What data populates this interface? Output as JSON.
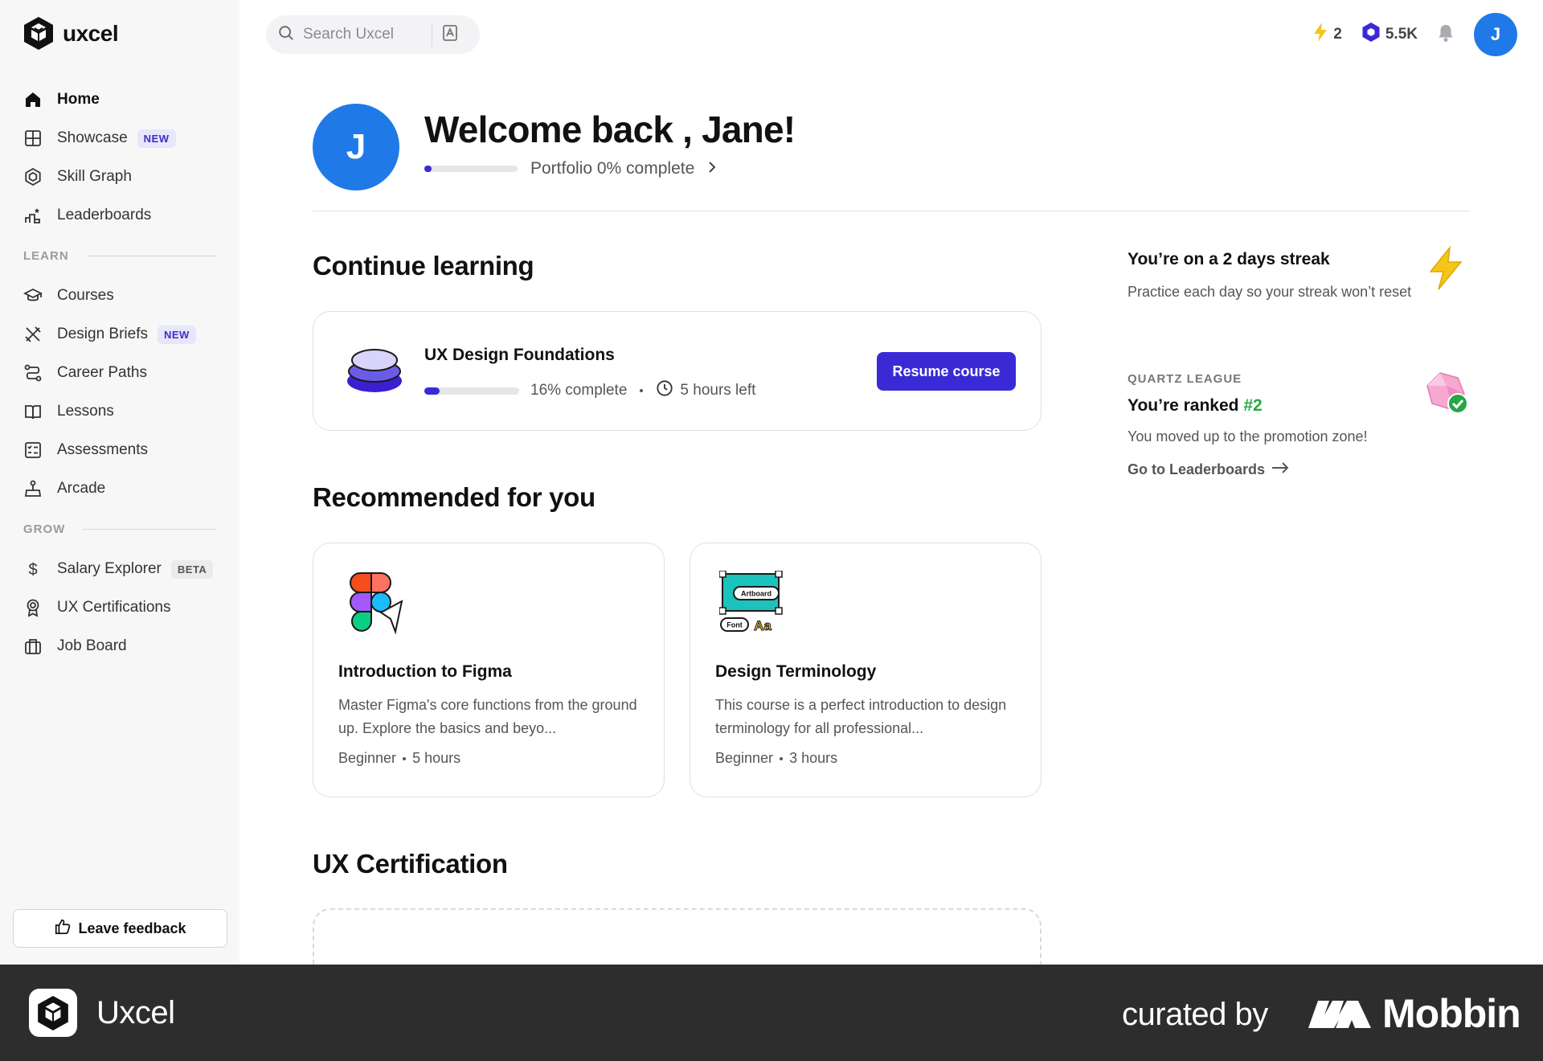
{
  "app": {
    "name": "uxcel"
  },
  "sidebar": {
    "items": [
      {
        "label": "Home",
        "icon": "home-icon",
        "active": true
      },
      {
        "label": "Showcase",
        "icon": "showcase-icon",
        "badge": "NEW"
      },
      {
        "label": "Skill Graph",
        "icon": "skill-graph-icon"
      },
      {
        "label": "Leaderboards",
        "icon": "leaderboards-icon"
      }
    ],
    "learn_label": "LEARN",
    "learn_items": [
      {
        "label": "Courses",
        "icon": "graduation-cap-icon"
      },
      {
        "label": "Design Briefs",
        "icon": "design-briefs-icon",
        "badge": "NEW"
      },
      {
        "label": "Career Paths",
        "icon": "career-paths-icon"
      },
      {
        "label": "Lessons",
        "icon": "book-icon"
      },
      {
        "label": "Assessments",
        "icon": "assessments-icon"
      },
      {
        "label": "Arcade",
        "icon": "arcade-icon"
      }
    ],
    "grow_label": "GROW",
    "grow_items": [
      {
        "label": "Salary Explorer",
        "icon": "dollar-icon",
        "badge": "BETA"
      },
      {
        "label": "UX Certifications",
        "icon": "certification-icon"
      },
      {
        "label": "Job Board",
        "icon": "briefcase-icon"
      }
    ],
    "feedback_label": "Leave feedback"
  },
  "header": {
    "search_placeholder": "Search Uxcel",
    "streak_count": "2",
    "xp": "5.5K",
    "avatar_initial": "J"
  },
  "welcome": {
    "avatar_initial": "J",
    "title": "Welcome back , Jane!",
    "portfolio_text": "Portfolio 0% complete",
    "portfolio_progress": 0.02
  },
  "continue": {
    "heading": "Continue learning",
    "course_title": "UX Design Foundations",
    "progress_text": "16% complete",
    "progress": 0.16,
    "time_left": "5 hours left",
    "button": "Resume course"
  },
  "recommended": {
    "heading": "Recommended for you",
    "cards": [
      {
        "title": "Introduction to Figma",
        "description": "Master Figma's core functions from the ground up. Explore the basics and beyo...",
        "level": "Beginner",
        "duration": "5 hours",
        "icon": "figma-icon"
      },
      {
        "title": "Design Terminology",
        "description": "This course is a perfect introduction to design terminology for all professional...",
        "level": "Beginner",
        "duration": "3 hours",
        "icon": "artboard-icon",
        "icon_labels": [
          "Artboard",
          "Font",
          "Aa"
        ]
      }
    ]
  },
  "certification": {
    "heading": "UX Certification"
  },
  "streak": {
    "title": "You’re on a 2 days streak",
    "description": "Practice each day so your streak won’t reset"
  },
  "league": {
    "label": "QUARTZ LEAGUE",
    "rank_prefix": "You’re ranked ",
    "rank": "#2",
    "description": "You moved up to the promotion zone!",
    "link": "Go to Leaderboards"
  },
  "footer": {
    "app_name": "Uxcel",
    "curated": "curated by",
    "brand": "Mobbin"
  },
  "colors": {
    "accent": "#3a2ad6",
    "avatar": "#1f7ae8",
    "rank_green": "#28a745",
    "streak_yellow": "#f5c518"
  }
}
